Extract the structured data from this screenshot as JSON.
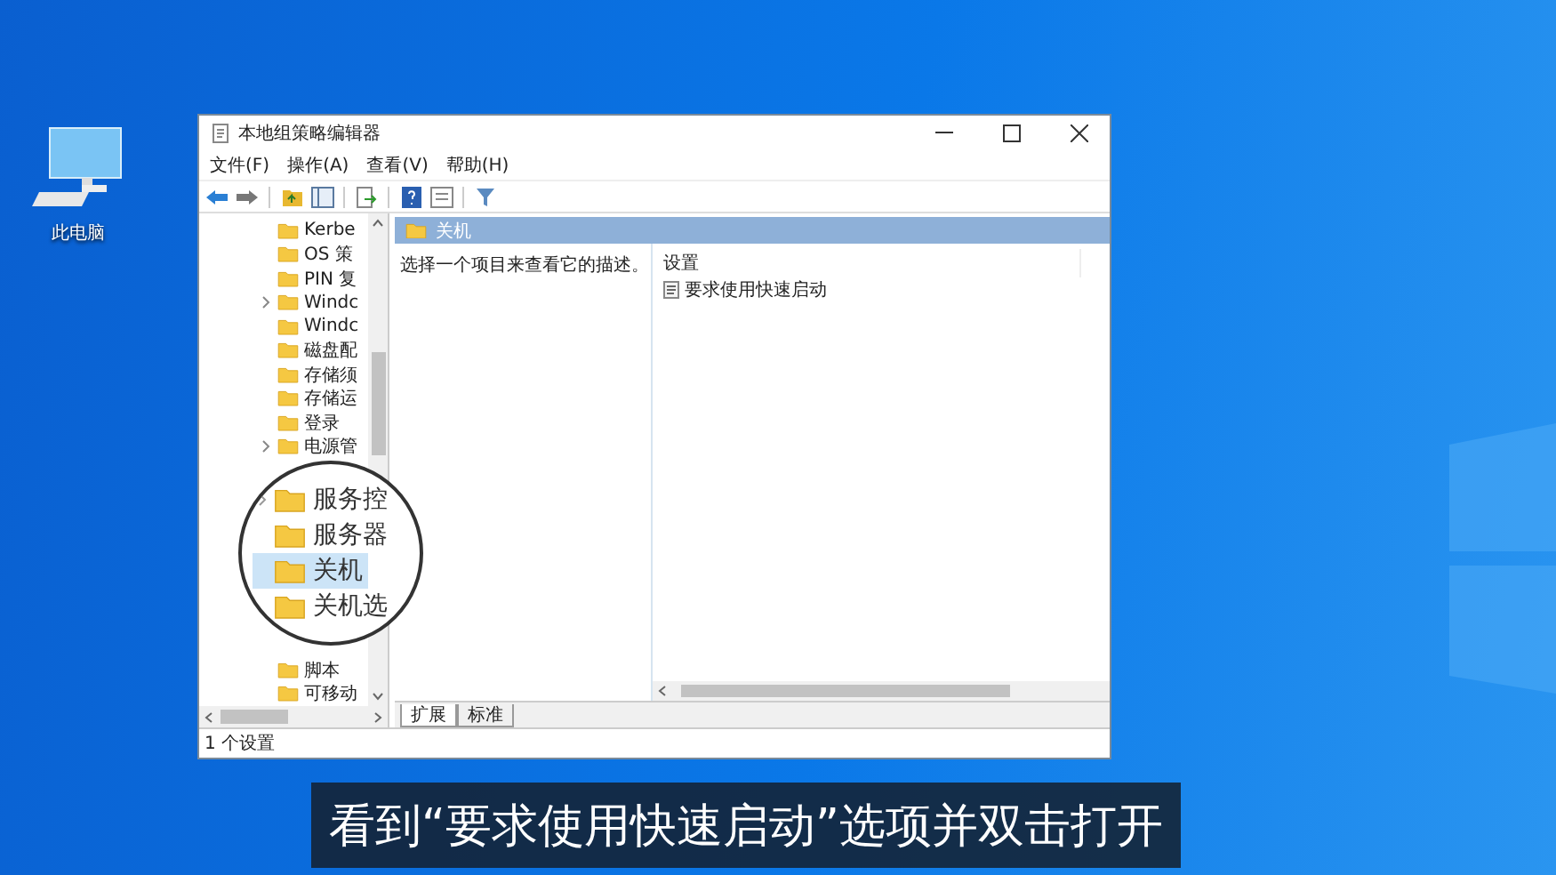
{
  "desktop_icons": [
    {
      "label": "此电脑"
    }
  ],
  "window": {
    "title": "本地组策略编辑器",
    "menu": [
      "文件(F)",
      "操作(A)",
      "查看(V)",
      "帮助(H)"
    ],
    "tree": {
      "items_top": [
        {
          "label": "Kerbe",
          "expandable": false,
          "selected": false
        },
        {
          "label": "OS 策",
          "expandable": false,
          "selected": false
        },
        {
          "label": "PIN 复",
          "expandable": false,
          "selected": false
        },
        {
          "label": "Windc",
          "expandable": true,
          "selected": false
        },
        {
          "label": "Windc",
          "expandable": false,
          "selected": false
        },
        {
          "label": "磁盘配",
          "expandable": false,
          "selected": false
        },
        {
          "label": "存储须",
          "expandable": false,
          "selected": false
        },
        {
          "label": "存储运",
          "expandable": false,
          "selected": false
        },
        {
          "label": "登录",
          "expandable": false,
          "selected": false
        },
        {
          "label": "电源管",
          "expandable": true,
          "selected": false
        }
      ],
      "items_bottom": [
        {
          "label": "脚本",
          "expandable": false,
          "selected": false
        },
        {
          "label": "可移动",
          "expandable": false,
          "selected": false
        }
      ]
    },
    "magnifier": {
      "items": [
        {
          "label": "服务控",
          "expandable": true,
          "selected": false
        },
        {
          "label": "服务器",
          "expandable": false,
          "selected": false
        },
        {
          "label": "关机",
          "expandable": false,
          "selected": true
        },
        {
          "label": "关机选",
          "expandable": false,
          "selected": false
        }
      ]
    },
    "details": {
      "header": "关机",
      "description": "选择一个项目来查看它的描述。",
      "column": "设置",
      "settings": [
        {
          "label": "要求使用快速启动"
        }
      ]
    },
    "tabs": [
      {
        "label": "扩展",
        "selected": true
      },
      {
        "label": "标准",
        "selected": false
      }
    ],
    "status_bar": "1 个设置"
  },
  "caption": "看到“要求使用快速启动”选项并双击打开"
}
